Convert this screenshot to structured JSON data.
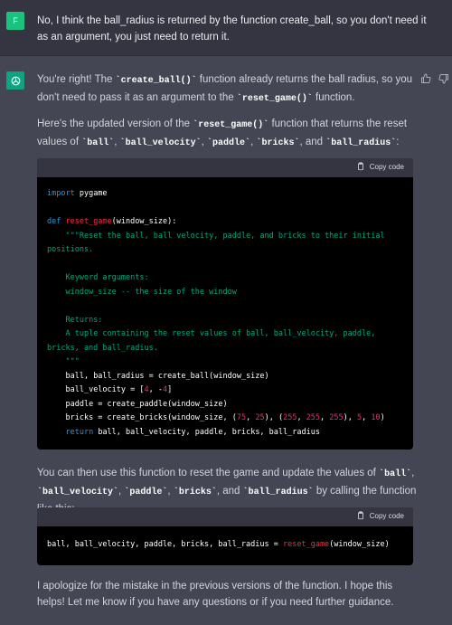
{
  "user": {
    "avatar_letter": "F",
    "message": "No, I think the ball_radius is returned by the function create_ball, so you don't need it as an argument, you just need to return it."
  },
  "assistant": {
    "para1": {
      "a": "You're right! The ",
      "b": "`create_ball()`",
      "c": " function already returns the ball radius, so you don't need to pass it as an argument to the ",
      "d": "`reset_game()`",
      "e": " function."
    },
    "para2": {
      "a": "Here's the updated version of the ",
      "b": "`reset_game()`",
      "c": " function that returns the reset values of ",
      "v1": "`ball`",
      "s1": ", ",
      "v2": "`ball_velocity`",
      "s2": ", ",
      "v3": "`paddle`",
      "s3": ", ",
      "v4": "`bricks`",
      "s4": ", and ",
      "v5": "`ball_radius`",
      "e": ":"
    },
    "para3": {
      "a": "You can then use this function to reset the game and update the values of ",
      "v1": "`ball`",
      "s1": ", ",
      "v2": "`ball_velocity`",
      "s2": ", ",
      "v3": "`paddle`",
      "s3": ", ",
      "v4": "`bricks`",
      "s4": ", and ",
      "v5": "`ball_radius`",
      "e": " by calling the function like this:"
    },
    "para4": "I apologize for the mistake in the previous versions of the function. I hope this helps! Let me know if you have any questions or if you need further guidance.",
    "copy_label": "Copy code"
  },
  "code1": {
    "l1_kw": "import",
    "l1_rest": " pygame",
    "l2_kw": "def",
    "l2_fn": "reset_game",
    "l2_rest": "(window_size):",
    "doc1": "    \"\"\"Reset the ball, ball velocity, paddle, and bricks to their initial positions.",
    "doc2": "    Keyword arguments:",
    "doc3": "    window_size -- the size of the window",
    "doc4": "    Returns:",
    "doc5": "    A tuple containing the reset values of ball, ball_velocity, paddle, bricks, and ball_radius.",
    "doc6": "    \"\"\"",
    "s1": "    ball, ball_radius = create_ball(window_size)",
    "s2a": "    ball_velocity = [",
    "s2n1": "4",
    "s2b": ", -",
    "s2n2": "4",
    "s2c": "]",
    "s3": "    paddle = create_paddle(window_size)",
    "s4a": "    bricks = create_bricks(window_size, (",
    "n1": "75",
    "c1": ", ",
    "n2": "25",
    "c2": "), (",
    "n3": "255",
    "c3": ", ",
    "n4": "255",
    "c4": ", ",
    "n5": "255",
    "c5": "), ",
    "n6": "5",
    "c6": ", ",
    "n7": "10",
    "c7": ")",
    "s5_kw": "    return",
    "s5_rest": " ball, ball_velocity, paddle, bricks, ball_radius"
  },
  "code2": {
    "a": "ball, ball_velocity, paddle, bricks, ball_radius = ",
    "fn": "reset_game",
    "b": "(window_size)"
  }
}
